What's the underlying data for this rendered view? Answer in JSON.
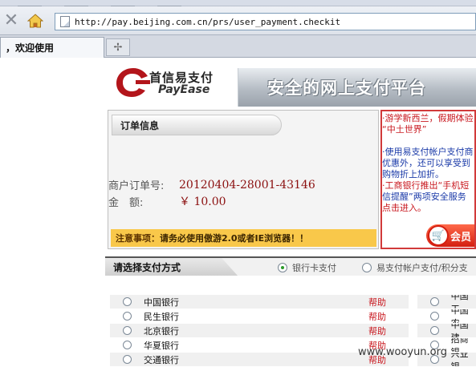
{
  "browser": {
    "url": "http://pay.beijing.com.cn/prs/user_payment.checkit",
    "tab_label": "，欢迎使用",
    "new_tab_symbol": "✢"
  },
  "header": {
    "logo_cn": "首信易支付",
    "logo_en": "PayEase",
    "banner": "安全的网上支付平台"
  },
  "order": {
    "title": "订单信息",
    "order_no_label": "商户订单号:",
    "order_no": "20120404-28001-43146",
    "amount_label": "金　额:",
    "amount": "￥ 10.00",
    "notice_title": "注意事项：",
    "notice_text": "请务必使用傲游2.0或者IE浏览器！！"
  },
  "promo": {
    "line1": "·游学新西兰，假期体验",
    "line2": "“中土世界”",
    "line3": "·使用易支付帐户支付商",
    "line4": "优惠外，还可以享受到",
    "line5": "购物折上加折。",
    "line6": "·工商银行推出“手机短",
    "line7": "信提醒”两项安全服务",
    "line8": "点击进入。",
    "member_label": "会员"
  },
  "payment": {
    "title": "请选择支付方式",
    "option_bank": "银行卡支付",
    "option_account": "易支付帐户支付/积分支",
    "help_label": "帮助",
    "left_banks": [
      "中国银行",
      "民生银行",
      "北京银行",
      "华夏银行",
      "交通银行"
    ],
    "right_banks": [
      "中国工",
      "中国农",
      "中国建",
      "招商银",
      "兴业银"
    ]
  },
  "watermark": "www.wooyun.org"
}
